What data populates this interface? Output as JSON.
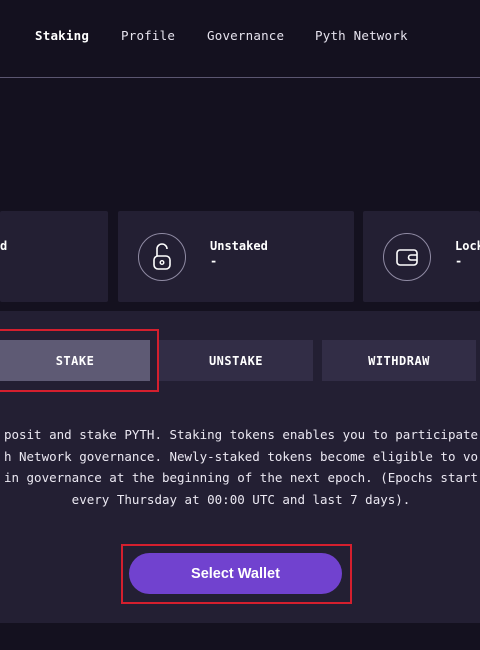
{
  "nav": {
    "items": [
      {
        "label": "Staking",
        "active": true
      },
      {
        "label": "Profile",
        "active": false
      },
      {
        "label": "Governance",
        "active": false
      },
      {
        "label": "Pyth Network",
        "active": false
      }
    ]
  },
  "cards": [
    {
      "label": "d",
      "value": "",
      "icon": null
    },
    {
      "label": "Unstaked",
      "value": "-",
      "icon": "unlocked-padlock-icon"
    },
    {
      "label": "Lock",
      "value": "-",
      "icon": "wallet-icon"
    }
  ],
  "tabs": [
    {
      "label": "STAKE",
      "active": true
    },
    {
      "label": "UNSTAKE",
      "active": false
    },
    {
      "label": "WITHDRAW",
      "active": false
    }
  ],
  "description": "posit and stake PYTH. Staking tokens enables you to participate\nh Network governance. Newly-staked tokens become eligible to vo\nin governance at the beginning of the next epoch. (Epochs start\nevery Thursday at 00:00 UTC and last 7 days).",
  "cta": {
    "label": "Select Wallet"
  },
  "colors": {
    "background": "#14111f",
    "card": "#231f33",
    "tab": "#322d46",
    "tab_active": "#5e5a74",
    "accent": "#7142cf",
    "highlight": "#d41f2e"
  }
}
